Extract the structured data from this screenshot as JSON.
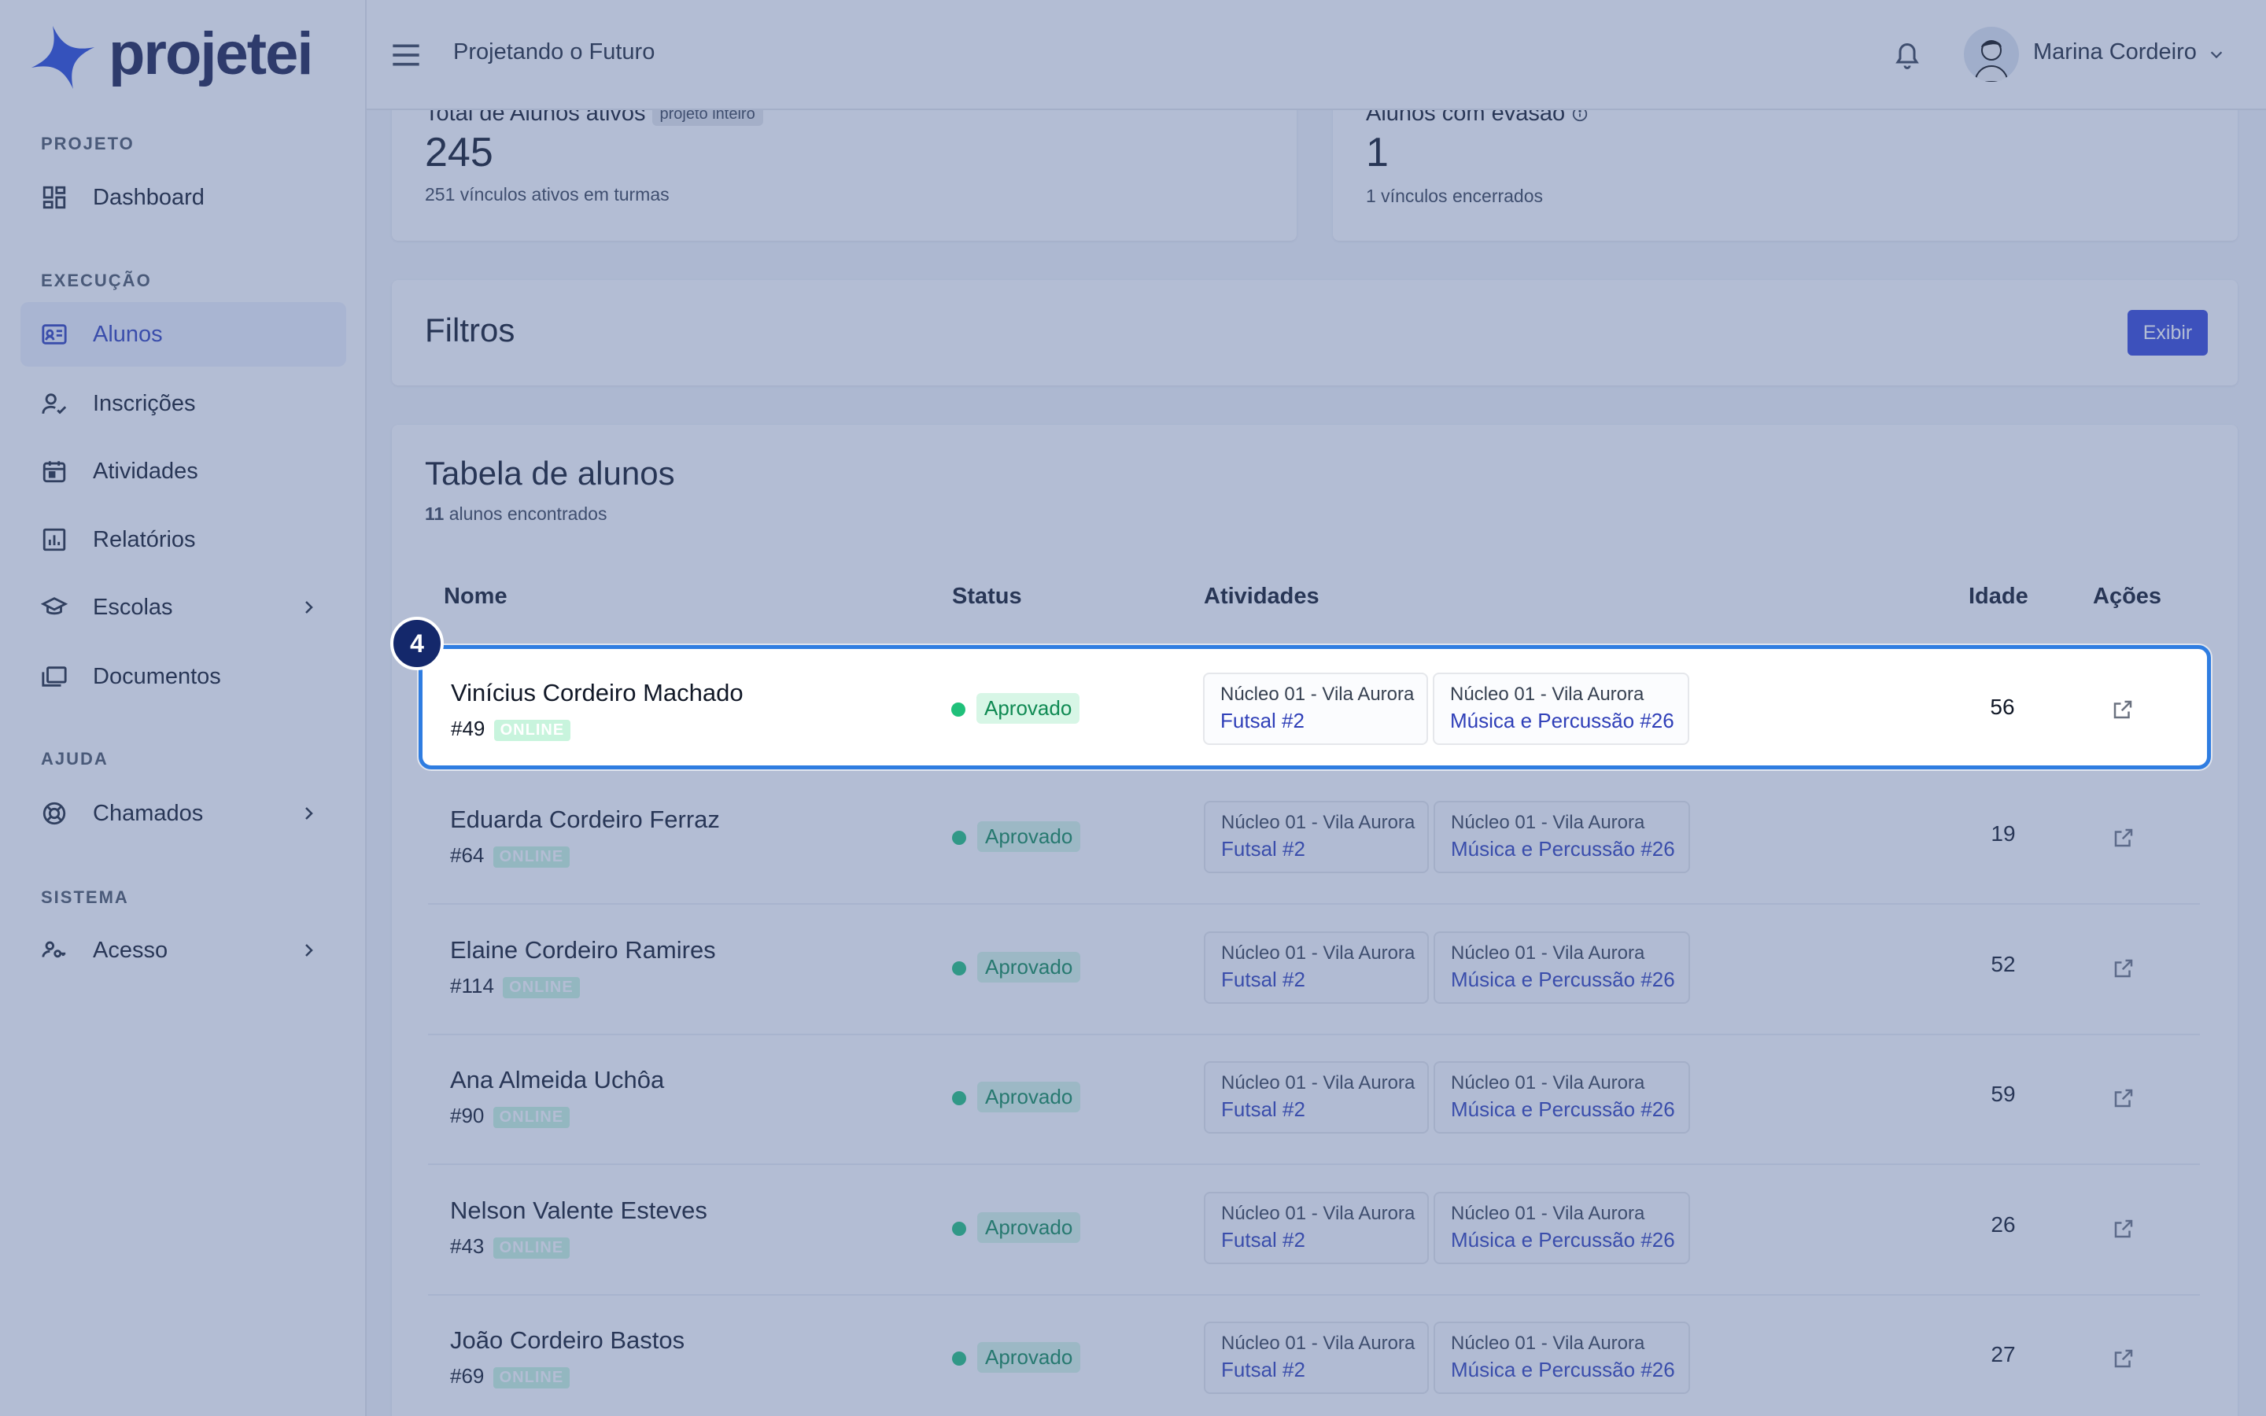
{
  "app": {
    "logo_text": "projetei",
    "project_name": "Projetando o Futuro"
  },
  "user": {
    "name": "Marina Cordeiro"
  },
  "sidebar": {
    "sections": [
      "PROJETO",
      "EXECUÇÃO",
      "AJUDA",
      "SISTEMA"
    ],
    "items": [
      {
        "label": "Dashboard",
        "icon": "dashboard-icon"
      },
      {
        "label": "Alunos",
        "icon": "id-card-icon",
        "active": true
      },
      {
        "label": "Inscrições",
        "icon": "user-check-icon"
      },
      {
        "label": "Atividades",
        "icon": "calendar-icon"
      },
      {
        "label": "Relatórios",
        "icon": "chart-icon"
      },
      {
        "label": "Escolas",
        "icon": "graduation-cap-icon"
      },
      {
        "label": "Documentos",
        "icon": "folders-icon"
      },
      {
        "label": "Chamados",
        "icon": "lifebuoy-icon"
      },
      {
        "label": "Acesso",
        "icon": "users-key-icon"
      }
    ]
  },
  "stats": {
    "total": {
      "label": "Total de Alunos ativos",
      "pill": "projeto inteiro",
      "value": "245",
      "sub": "251 vínculos ativos em turmas"
    },
    "evasao": {
      "label": "Alunos com evasão",
      "value": "1",
      "sub": "1 vínculos encerrados"
    }
  },
  "filters": {
    "title": "Filtros",
    "button": "Exibir"
  },
  "table": {
    "title": "Tabela de alunos",
    "count": "11",
    "count_suffix": "alunos encontrados",
    "columns": [
      "Nome",
      "Status",
      "Atividades",
      "Idade",
      "Ações"
    ],
    "rows": [
      {
        "name": "Vinícius Cordeiro Machado",
        "id": "#49",
        "badge": "ONLINE",
        "status": "Aprovado",
        "tag1_top": "Núcleo 01 - Vila Aurora",
        "tag1_bottom": "Futsal #2",
        "tag2_top": "Núcleo 01 - Vila Aurora",
        "tag2_bottom": "Música e Percussão #26",
        "age": "56"
      },
      {
        "name": "Eduarda Cordeiro Ferraz",
        "id": "#64",
        "badge": "ONLINE",
        "status": "Aprovado",
        "tag1_top": "Núcleo 01 - Vila Aurora",
        "tag1_bottom": "Futsal #2",
        "tag2_top": "Núcleo 01 - Vila Aurora",
        "tag2_bottom": "Música e Percussão #26",
        "age": "19"
      },
      {
        "name": "Elaine Cordeiro Ramires",
        "id": "#114",
        "badge": "ONLINE",
        "status": "Aprovado",
        "tag1_top": "Núcleo 01 - Vila Aurora",
        "tag1_bottom": "Futsal #2",
        "tag2_top": "Núcleo 01 - Vila Aurora",
        "tag2_bottom": "Música e Percussão #26",
        "age": "52"
      },
      {
        "name": "Ana Almeida Uchôa",
        "id": "#90",
        "badge": "ONLINE",
        "status": "Aprovado",
        "tag1_top": "Núcleo 01 - Vila Aurora",
        "tag1_bottom": "Futsal #2",
        "tag2_top": "Núcleo 01 - Vila Aurora",
        "tag2_bottom": "Música e Percussão #26",
        "age": "59"
      },
      {
        "name": "Nelson Valente Esteves",
        "id": "#43",
        "badge": "ONLINE",
        "status": "Aprovado",
        "tag1_top": "Núcleo 01 - Vila Aurora",
        "tag1_bottom": "Futsal #2",
        "tag2_top": "Núcleo 01 - Vila Aurora",
        "tag2_bottom": "Música e Percussão #26",
        "age": "26"
      },
      {
        "name": "João Cordeiro Bastos",
        "id": "#69",
        "badge": "ONLINE",
        "status": "Aprovado",
        "tag1_top": "Núcleo 01 - Vila Aurora",
        "tag1_bottom": "Futsal #2",
        "tag2_top": "Núcleo 01 - Vila Aurora",
        "tag2_bottom": "Música e Percussão #26",
        "age": "27"
      }
    ]
  },
  "tour": {
    "step": "4"
  },
  "colors": {
    "accent": "#3446d6",
    "brand": "#1a1f4d",
    "status_ok": "#20c07a",
    "highlight": "#2f7de1"
  }
}
